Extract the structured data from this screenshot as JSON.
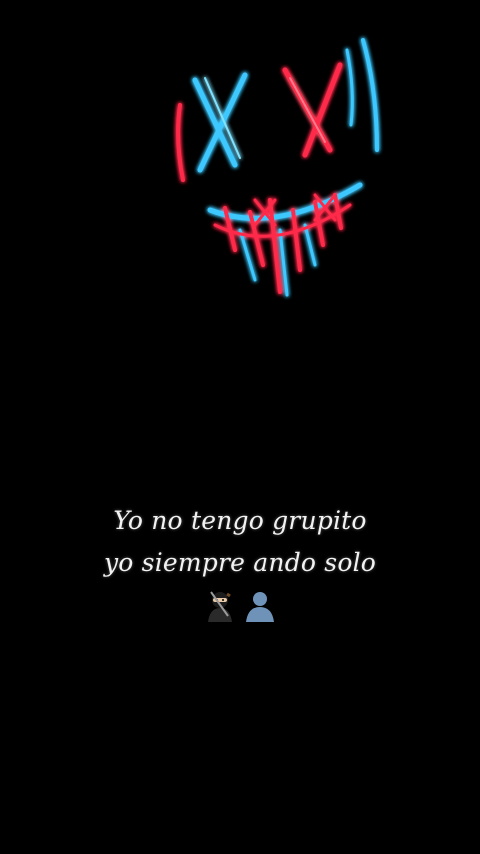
{
  "caption": {
    "line1": "Yo no tengo grupito",
    "line2": "yo siempre ando solo"
  },
  "emojis": [
    {
      "icon": "ninja-icon"
    },
    {
      "icon": "bust-silhouette-icon"
    }
  ],
  "colors": {
    "background": "#000000",
    "neon_blue": "#3ec9ff",
    "neon_red": "#ff2a4a",
    "text": "#f2f2f2"
  }
}
